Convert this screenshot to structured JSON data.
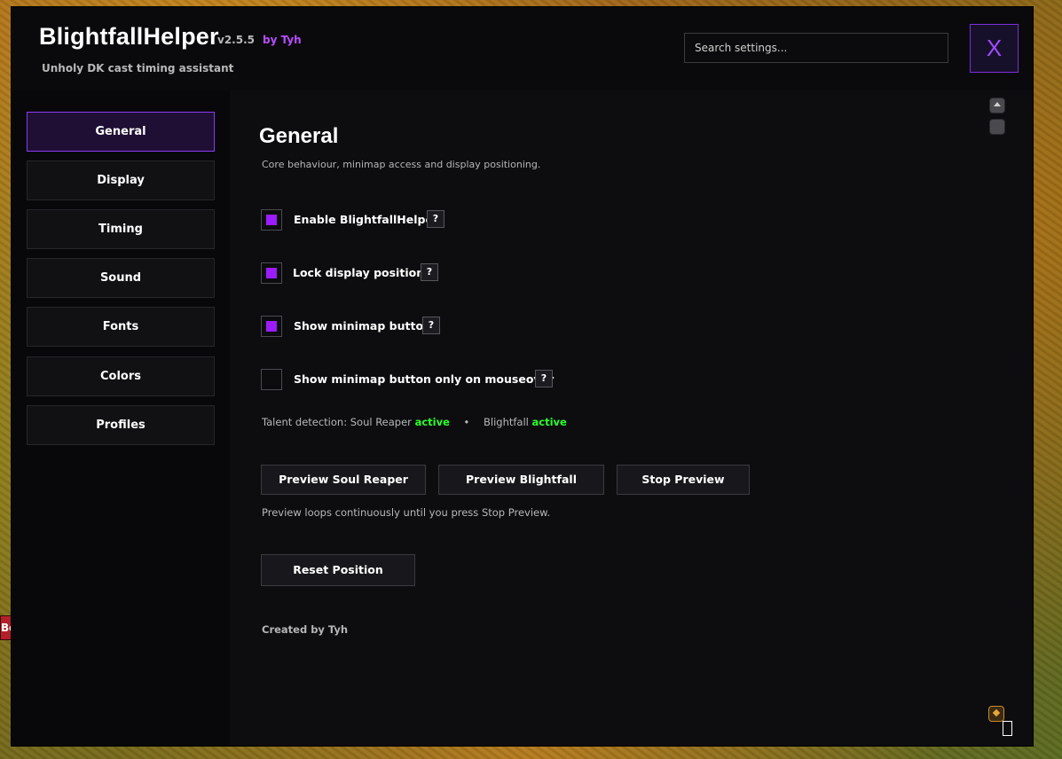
{
  "header": {
    "title": "BlightfallHelper",
    "version": "v2.5.5",
    "author": "by Tyh",
    "subtitle": "Unholy DK cast timing assistant",
    "search_placeholder": "Search settings...",
    "close_label": "X"
  },
  "sidebar": {
    "items": [
      {
        "label": "General",
        "active": true
      },
      {
        "label": "Display",
        "active": false
      },
      {
        "label": "Timing",
        "active": false
      },
      {
        "label": "Sound",
        "active": false
      },
      {
        "label": "Fonts",
        "active": false
      },
      {
        "label": "Colors",
        "active": false
      },
      {
        "label": "Profiles",
        "active": false
      }
    ]
  },
  "main": {
    "title": "General",
    "description": "Core behaviour, minimap access and display positioning.",
    "options": [
      {
        "label": "Enable BlightfallHelper",
        "checked": true,
        "help": "?"
      },
      {
        "label": "Lock display position",
        "checked": true,
        "help": "?"
      },
      {
        "label": "Show minimap button",
        "checked": true,
        "help": "?"
      },
      {
        "label": "Show minimap button only on mouseover",
        "checked": false,
        "help": "?"
      }
    ],
    "talent": {
      "prefix": "Talent detection: Soul Reaper",
      "soul_reaper_status": "active",
      "separator": "•",
      "blightfall_label": "Blightfall",
      "blightfall_status": "active"
    },
    "buttons": {
      "preview_soul_reaper": "Preview Soul Reaper",
      "preview_blightfall": "Preview Blightfall",
      "stop_preview": "Stop Preview",
      "reset_position": "Reset Position"
    },
    "preview_note": "Preview loops continuously until you press Stop Preview.",
    "credit": "Created by Tyh"
  },
  "colors": {
    "accent": "#9b1dff",
    "accent_border": "#8a3bf0",
    "status_active": "#2bff2b",
    "author": "#b94dff"
  },
  "background": {
    "side_tag_text": "Be"
  }
}
